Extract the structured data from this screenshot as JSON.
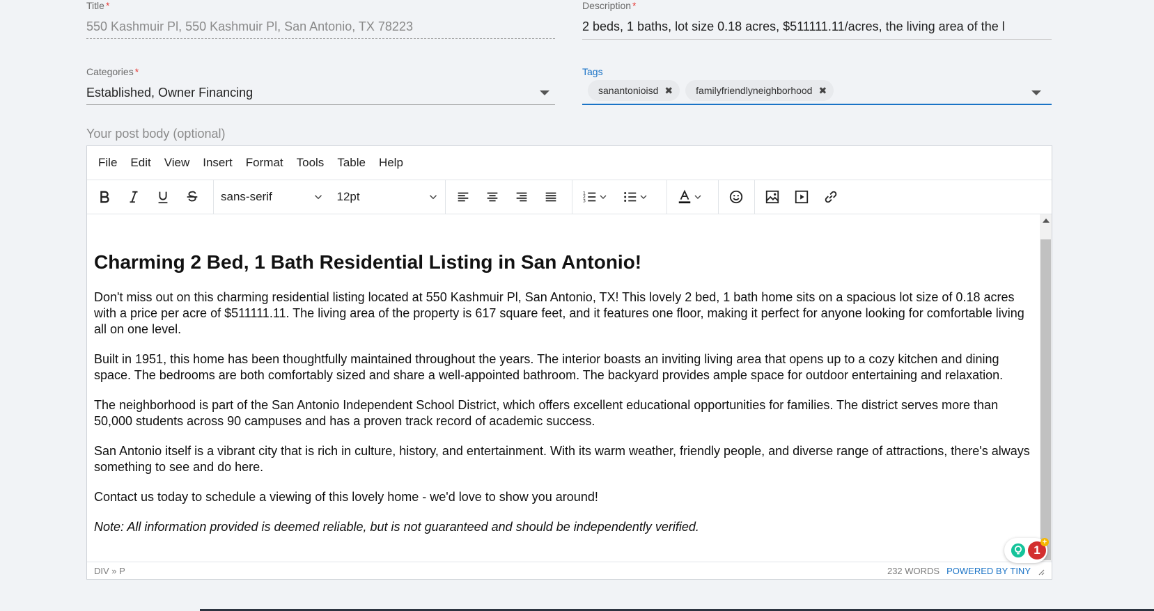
{
  "title_field": {
    "label": "Title",
    "required_mark": "*",
    "value": "550 Kashmuir Pl, 550 Kashmuir Pl, San Antonio, TX 78223"
  },
  "description_field": {
    "label": "Description",
    "required_mark": "*",
    "value": "2 beds, 1 baths, lot size 0.18 acres, $511111.11/acres, the living area of the l"
  },
  "categories_field": {
    "label": "Categories",
    "required_mark": "*",
    "value": "Established, Owner Financing"
  },
  "tags_field": {
    "label": "Tags",
    "chips": [
      "sanantonioisd",
      "familyfriendlyneighborhood"
    ],
    "remove_glyph": "✖"
  },
  "post_body_label": "Your post body (optional)",
  "editor": {
    "menu": [
      "File",
      "Edit",
      "View",
      "Insert",
      "Format",
      "Tools",
      "Table",
      "Help"
    ],
    "font_family": "sans-serif",
    "font_size": "12pt",
    "heading": "Charming 2 Bed, 1 Bath Residential Listing in San Antonio!",
    "paragraphs": [
      "Don't miss out on this charming residential listing located at 550 Kashmuir Pl, San Antonio, TX! This lovely 2 bed, 1 bath home sits on a spacious lot size of 0.18 acres with a price per acre of $511111.11. The living area of the property is 617 square feet, and it features one floor, making it perfect for anyone looking for comfortable living all on one level.",
      "Built in 1951, this home has been thoughtfully maintained throughout the years. The interior boasts an inviting living area that opens up to a cozy kitchen and dining space. The bedrooms are both comfortably sized and share a well-appointed bathroom. The backyard provides ample space for outdoor entertaining and relaxation.",
      "The neighborhood is part of the San Antonio Independent School District, which offers excellent educational opportunities for families. The district serves more than 50,000 students across 90 campuses and has a proven track record of academic success.",
      "San Antonio itself is a vibrant city that is rich in culture, history, and entertainment. With its warm weather, friendly people, and diverse range of attractions, there's always something to see and do here.",
      "Contact us today to schedule a viewing of this lovely home - we'd love to show you around!"
    ],
    "note": "Note: All information provided is deemed reliable, but is not guaranteed and should be independently verified.",
    "status_path": "DIV » P",
    "word_count": "232 WORDS",
    "powered_by": "POWERED BY TINY"
  },
  "grammarly_badge": "1",
  "colors": {
    "accent": "#1a73c6",
    "required": "#e53935",
    "badge": "#d32f2f",
    "grammarly_green": "#15c39a"
  },
  "icons": [
    "bold-icon",
    "italic-icon",
    "underline-icon",
    "strikethrough-icon",
    "chevron-down-icon",
    "align-left-icon",
    "align-center-icon",
    "align-right-icon",
    "align-justify-icon",
    "numbered-list-icon",
    "bullet-list-icon",
    "text-color-icon",
    "emoji-icon",
    "image-icon",
    "media-icon",
    "link-icon",
    "close-icon",
    "grammarly-icon"
  ]
}
